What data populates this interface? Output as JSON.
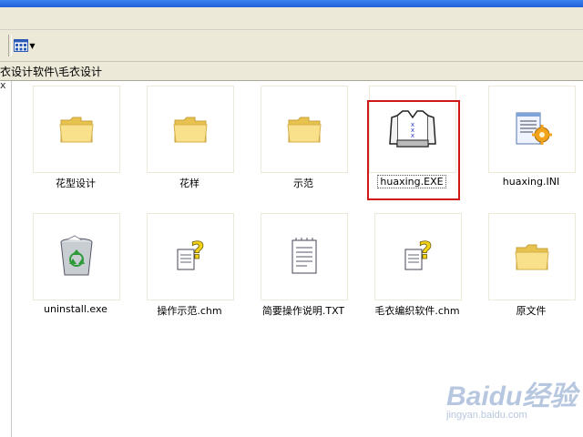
{
  "address": {
    "path": "衣设计软件\\毛衣设计"
  },
  "leftpane": {
    "close_glyph": "x"
  },
  "files": [
    {
      "name": "花型设计",
      "icon": "folder-icon"
    },
    {
      "name": "花样",
      "icon": "folder-icon"
    },
    {
      "name": "示范",
      "icon": "folder-icon"
    },
    {
      "name": "huaxing.EXE",
      "icon": "sweater-exe-icon",
      "selected": true
    },
    {
      "name": "huaxing.INI",
      "icon": "ini-settings-icon"
    },
    {
      "name": "uninstall.exe",
      "icon": "recycle-bin-icon"
    },
    {
      "name": "操作示范.chm",
      "icon": "chm-help-icon"
    },
    {
      "name": "简要操作说明.TXT",
      "icon": "text-file-icon"
    },
    {
      "name": "毛衣编织软件.chm",
      "icon": "chm-help-icon"
    },
    {
      "name": "原文件",
      "icon": "folder-icon"
    }
  ],
  "watermark": {
    "logo": "Baidu经验",
    "url": "jingyan.baidu.com"
  },
  "colors": {
    "selection_outline": "#d01818",
    "folder": "#f6d96e",
    "titlebar": "#2a6fe0"
  }
}
